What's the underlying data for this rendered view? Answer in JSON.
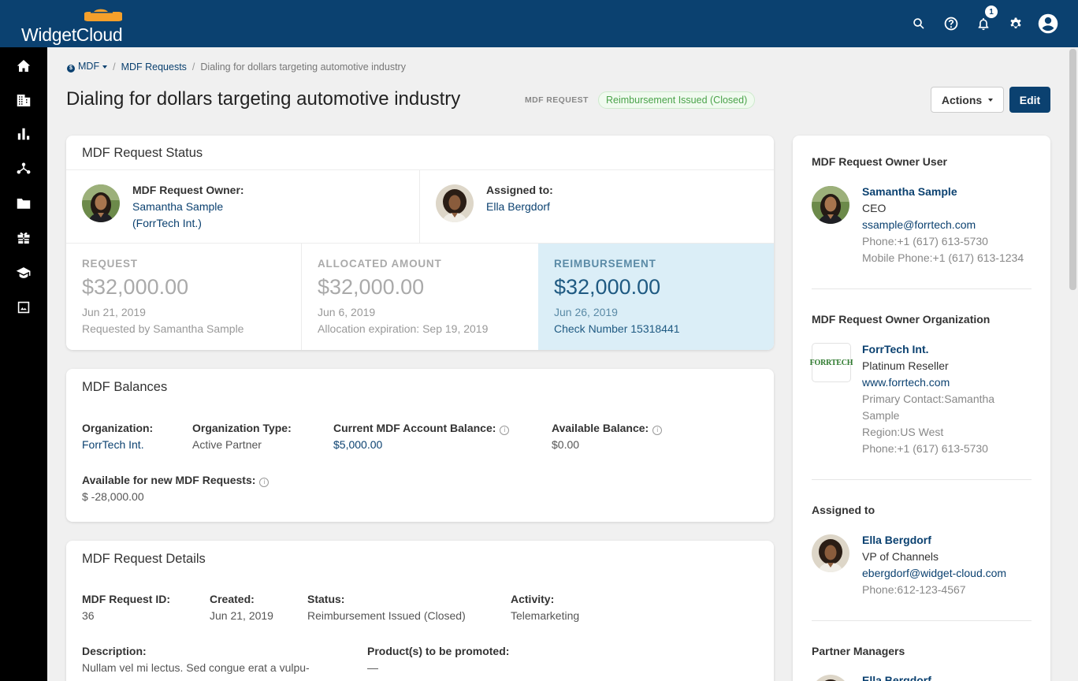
{
  "app": {
    "logo_text": "WidgetCloud",
    "notification_count": "1"
  },
  "topbar_icons": [
    "search-icon",
    "help-icon",
    "bell-icon",
    "gear-icon",
    "account-icon"
  ],
  "sidebar_icons": [
    "home-icon",
    "building-icon",
    "bar-chart-icon",
    "network-icon",
    "folder-icon",
    "gift-icon",
    "graduation-cap-icon",
    "image-icon"
  ],
  "breadcrumb": {
    "root": "MDF",
    "section": "MDF Requests",
    "current": "Dialing for dollars targeting automotive industry"
  },
  "header": {
    "title": "Dialing for dollars targeting automotive industry",
    "type_label": "MDF REQUEST",
    "status": "Reimbursement Issued (Closed)",
    "actions_label": "Actions",
    "edit_label": "Edit"
  },
  "status_card": {
    "title": "MDF Request Status",
    "owner": {
      "label": "MDF Request Owner:",
      "name": "Samantha Sample",
      "org": "(ForrTech Int.)"
    },
    "assignee": {
      "label": "Assigned to:",
      "name": "Ella Bergdorf"
    },
    "amounts": [
      {
        "caption": "REQUEST",
        "value": "$32,000.00",
        "date": "Jun 21, 2019",
        "note": "Requested by Samantha Sample"
      },
      {
        "caption": "ALLOCATED AMOUNT",
        "value": "$32,000.00",
        "date": "Jun 6, 2019",
        "note": "Allocation expiration: Sep 19, 2019"
      },
      {
        "caption": "REIMBURSEMENT",
        "value": "$32,000.00",
        "date": "Jun 26, 2019",
        "note": "Check Number 15318441"
      }
    ]
  },
  "balances_card": {
    "title": "MDF Balances",
    "organization": {
      "label": "Organization:",
      "value": "ForrTech Int."
    },
    "org_type": {
      "label": "Organization Type:",
      "value": "Active Partner"
    },
    "account_balance": {
      "label": "Current MDF Account Balance:",
      "value": "$5,000.00"
    },
    "available_balance": {
      "label": "Available Balance:",
      "value": "$0.00"
    },
    "available_new": {
      "label": "Available for new MDF Requests:",
      "value": "$ -28,000.00"
    }
  },
  "details_card": {
    "title": "MDF Request Details",
    "request_id": {
      "label": "MDF Request ID:",
      "value": "36"
    },
    "created": {
      "label": "Created:",
      "value": "Jun 21, 2019"
    },
    "status": {
      "label": "Status:",
      "value": "Reimbursement Issued (Closed)"
    },
    "activity": {
      "label": "Activity:",
      "value": "Telemarketing"
    },
    "description": {
      "label": "Description:",
      "value": "Nullam vel mi lectus. Sed congue erat a vulpu-"
    },
    "products": {
      "label": "Product(s) to be promoted:",
      "value": "—"
    }
  },
  "right_panel": {
    "owner_user": {
      "title": "MDF Request Owner User",
      "name": "Samantha Sample",
      "role": "CEO",
      "email": "ssample@forrtech.com",
      "phone_label": "Phone:",
      "phone": "+1 (617) 613-5730",
      "mobile_label": "Mobile Phone:",
      "mobile": "+1 (617) 613-1234"
    },
    "owner_org": {
      "title": "MDF Request Owner Organization",
      "logo_text": "FORRTECH",
      "name": "ForrTech Int.",
      "tier": "Platinum Reseller",
      "website": "www.forrtech.com",
      "contact_label": "Primary Contact:",
      "contact_line1": "Samantha",
      "contact_line2": "Sample",
      "region_label": "Region:",
      "region": "US West",
      "phone_label": "Phone:",
      "phone": "+1 (617) 613-5730"
    },
    "assigned_to": {
      "title": "Assigned to",
      "name": "Ella Bergdorf",
      "role": "VP of Channels",
      "email": "ebergdorf@widget-cloud.com",
      "phone_label": "Phone:",
      "phone": "612-123-4567"
    },
    "partner_managers": {
      "title": "Partner Managers",
      "name": "Ella Bergdorf"
    }
  }
}
